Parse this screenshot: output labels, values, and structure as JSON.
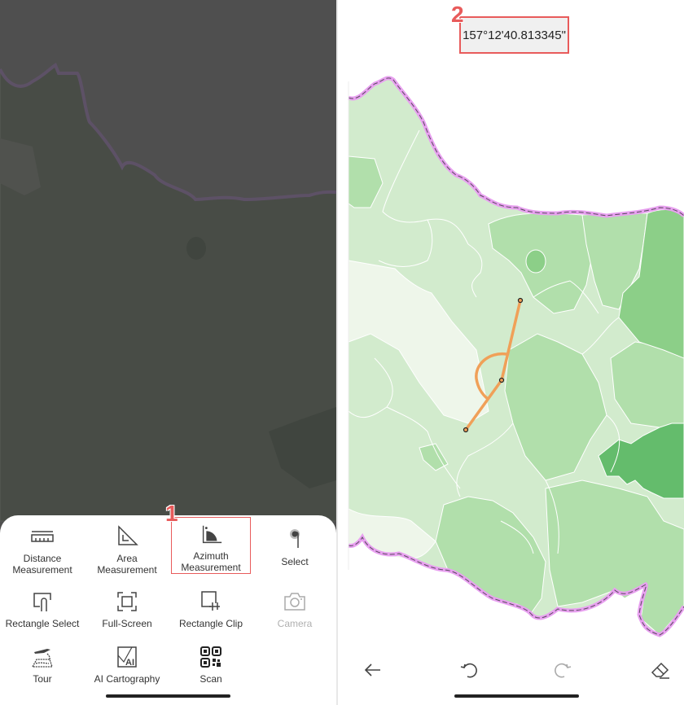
{
  "left_panel": {
    "annotation_marker": "1",
    "tools": [
      {
        "id": "distance",
        "label_line1": "Distance",
        "label_line2": "Measurement",
        "icon": "ruler-icon",
        "enabled": true,
        "highlighted": false
      },
      {
        "id": "area",
        "label_line1": "Area",
        "label_line2": "Measurement",
        "icon": "set-square-icon",
        "enabled": true,
        "highlighted": false
      },
      {
        "id": "azimuth",
        "label_line1": "Azimuth",
        "label_line2": "Measurement",
        "icon": "azimuth-angle-icon",
        "enabled": true,
        "highlighted": true
      },
      {
        "id": "select",
        "label_line1": "Select",
        "label_line2": "",
        "icon": "tap-pointer-icon",
        "enabled": true,
        "highlighted": false
      },
      {
        "id": "rect-select",
        "label_line1": "Rectangle Select",
        "label_line2": "",
        "icon": "rectangle-select-icon",
        "enabled": true,
        "highlighted": false
      },
      {
        "id": "fullscreen",
        "label_line1": "Full-Screen",
        "label_line2": "",
        "icon": "fullscreen-icon",
        "enabled": true,
        "highlighted": false
      },
      {
        "id": "rect-clip",
        "label_line1": "Rectangle Clip",
        "label_line2": "",
        "icon": "crop-icon",
        "enabled": true,
        "highlighted": false
      },
      {
        "id": "camera",
        "label_line1": "Camera",
        "label_line2": "",
        "icon": "camera-icon",
        "enabled": false,
        "highlighted": false
      },
      {
        "id": "tour",
        "label_line1": "Tour",
        "label_line2": "",
        "icon": "plane-tour-icon",
        "enabled": true,
        "highlighted": false
      },
      {
        "id": "ai-cartography",
        "label_line1": "AI Cartography",
        "label_line2": "",
        "icon": "ai-map-icon",
        "enabled": true,
        "highlighted": false
      },
      {
        "id": "scan",
        "label_line1": "Scan",
        "label_line2": "",
        "icon": "qr-code-icon",
        "enabled": true,
        "highlighted": false
      }
    ]
  },
  "right_panel": {
    "annotation_marker": "2",
    "azimuth_readout": "157°12'40.813345\"",
    "toolbar": {
      "back": "arrow-left-icon",
      "undo": "undo-icon",
      "redo": "redo-icon",
      "clear": "eraser-icon",
      "redo_enabled": false
    }
  },
  "colors": {
    "highlight": "#e85b5b",
    "measure_line": "#f0a058",
    "boundary": "#e8a0f0",
    "green_lightest": "#eef6ea",
    "green_light": "#d2ebcd",
    "green_mid": "#b1dfab",
    "green_dark": "#8ccf88",
    "green_darkest": "#64bc6c"
  }
}
